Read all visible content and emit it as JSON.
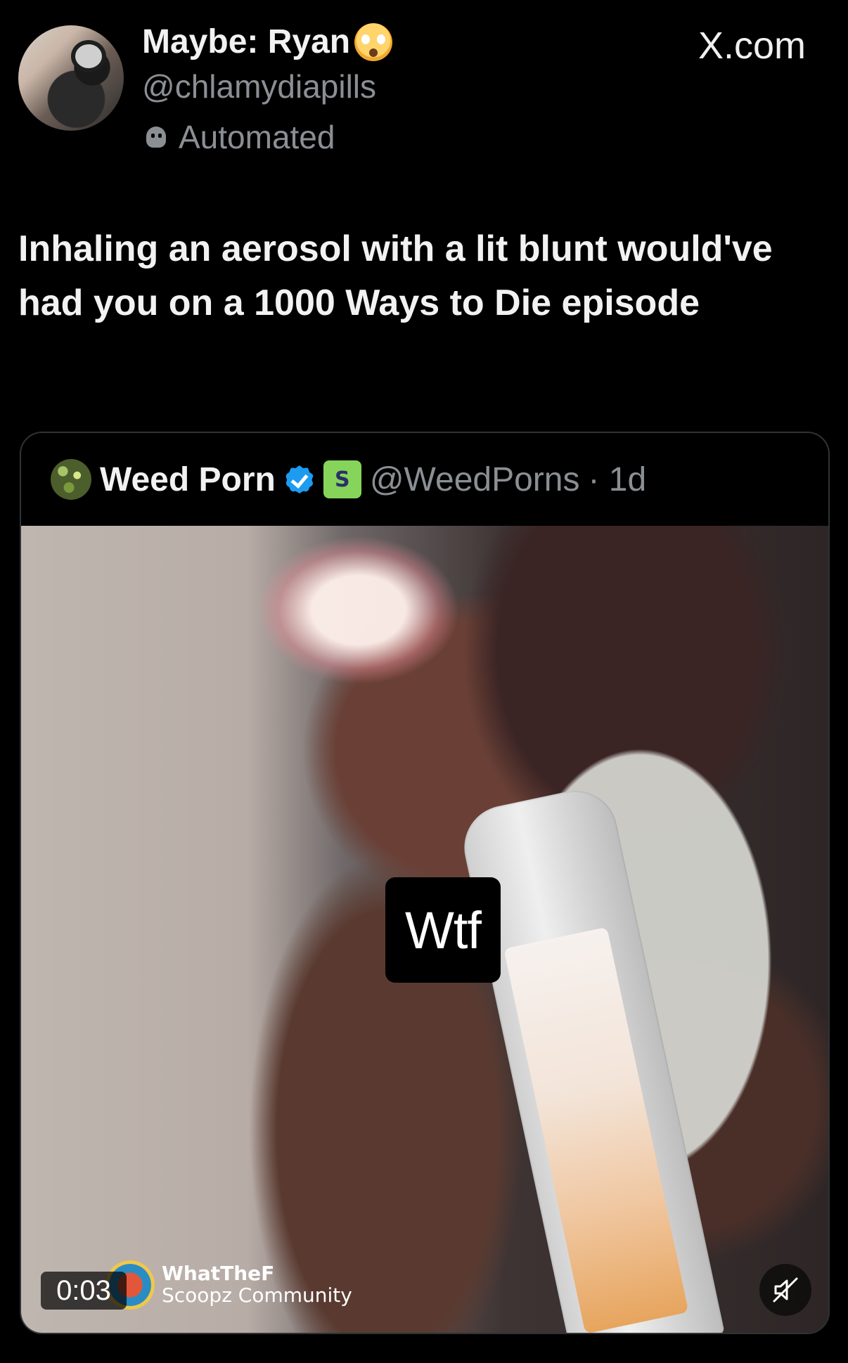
{
  "header": {
    "display_name": "Maybe: Ryan",
    "handle": "@chlamydiapills",
    "automated_label": "Automated",
    "site_label": "X.com"
  },
  "tweet": {
    "text": "Inhaling an aerosol with a lit blunt would've had you on a 1000 Ways to Die episode"
  },
  "quote": {
    "name": "Weed Porn",
    "handle": "@WeedPorns",
    "time": "· 1d",
    "video": {
      "sticker_text": "Wtf",
      "timestamp": "0:03",
      "watermark_title": "WhatTheF",
      "watermark_sub": "Scoopz Community"
    }
  },
  "icons": {
    "emoji": "face-with-open-eyes-and-hand-over-mouth",
    "automated": "bot-icon",
    "verified": "verified-badge-icon",
    "affiliate": "affiliate-badge-icon",
    "mute": "muted-speaker-icon"
  },
  "colors": {
    "background": "#000000",
    "text_primary": "#e7e9ea",
    "text_secondary": "#8b8f94",
    "verified_blue": "#1d9bf0",
    "affiliate_green": "#86d45a",
    "border": "#2f3336"
  }
}
